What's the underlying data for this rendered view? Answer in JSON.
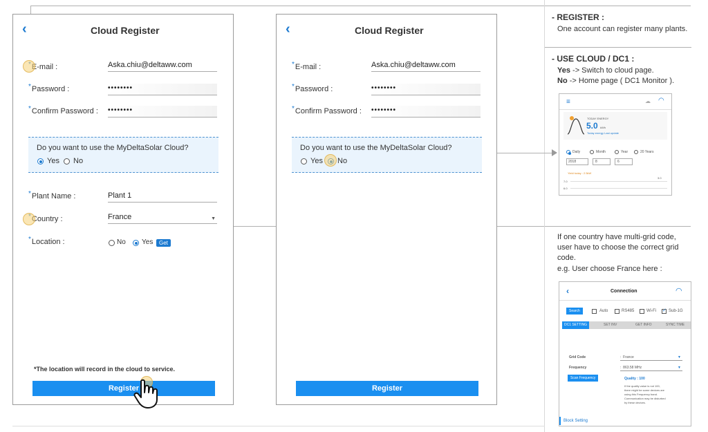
{
  "left_panel": {
    "title": "Cloud Register",
    "email_label": "E-mail :",
    "email_value": "Aska.chiu@deltaww.com",
    "password_label": "Password :",
    "password_value": "••••••••",
    "confirm_label": "Confirm Password  :",
    "confirm_value": "••••••••",
    "cloud_question": "Do you want to use the MyDeltaSolar Cloud?",
    "yes_label": "Yes",
    "no_label": "No",
    "plant_name_label": "Plant Name  :",
    "plant_name_value": "Plant 1",
    "country_label": "Country :",
    "country_value": "France",
    "location_label": "Location :",
    "location_no": "No",
    "location_yes": "Yes",
    "get_label": "Get",
    "note": "*The location will record in the cloud to service.",
    "register_label": "Register"
  },
  "middle_panel": {
    "title": "Cloud Register",
    "email_label": "E-mail :",
    "email_value": "Aska.chiu@deltaww.com",
    "password_label": "Password :",
    "password_value": "••••••••",
    "confirm_label": "Confirm Password  :",
    "confirm_value": "••••••••",
    "cloud_question": "Do you want to use the MyDeltaSolar Cloud?",
    "yes_label": "Yes",
    "no_label": "No",
    "register_label": "Register"
  },
  "right": {
    "register_title": "- REGISTER :",
    "register_desc": "One account can register many plants.",
    "use_cloud_title": "- USE CLOUD / DC1 :",
    "yes_key": "Yes",
    "yes_desc": " ->  Switch to  cloud page.",
    "no_key": "No",
    "no_desc": "  ->  Home page ( DC1 Monitor ).",
    "grid_line1": "If one country have  multi-grid code,",
    "grid_line2": "user have to choose the correct grid",
    "grid_line3": "code.",
    "grid_line4": "e.g. User choose France here :"
  },
  "dc1_thumb": {
    "today_energy": "TODAY ENERGY",
    "energy_value": "5.0",
    "energy_unit": "kWh",
    "sub_text": "Today energy   Last update",
    "daily": "Daily",
    "month": "Month",
    "year": "Year",
    "years20": "20 Years",
    "year_val": "2018",
    "month_val": "8",
    "day_val": "6",
    "legend": "Yield today : 2.5kW",
    "y1": "7.0",
    "y2": "6.0",
    "top_val": "3.0"
  },
  "connection_thumb": {
    "title": "Connection",
    "search": "Search",
    "auto": "Auto",
    "rs485": "RS485",
    "wifi": "Wi-Fi",
    "sub1g": "Sub-1G",
    "tab1": "DC1 SETTING",
    "tab2": "SET INV",
    "tab3": "GET INFO",
    "tab4": "SYNC TIME",
    "grid_code_label": "Grid Code",
    "grid_code_value": "France",
    "frequency_label": "Frequency",
    "frequency_value": "863.58 MHz",
    "scan_label": "Scan Frequency",
    "quality": "Quality : 100",
    "desc1": "If the quality value is not 100,",
    "desc2": "there might be some devices are",
    "desc3": "using this Frequency band.",
    "desc4": "Communication may be disturbed",
    "desc5": "by these devices.",
    "block": "Block Setting"
  },
  "colors": {
    "accent": "#1c7ad0",
    "button": "#1a8ff0",
    "cloud_bg": "#eaf4fd"
  }
}
